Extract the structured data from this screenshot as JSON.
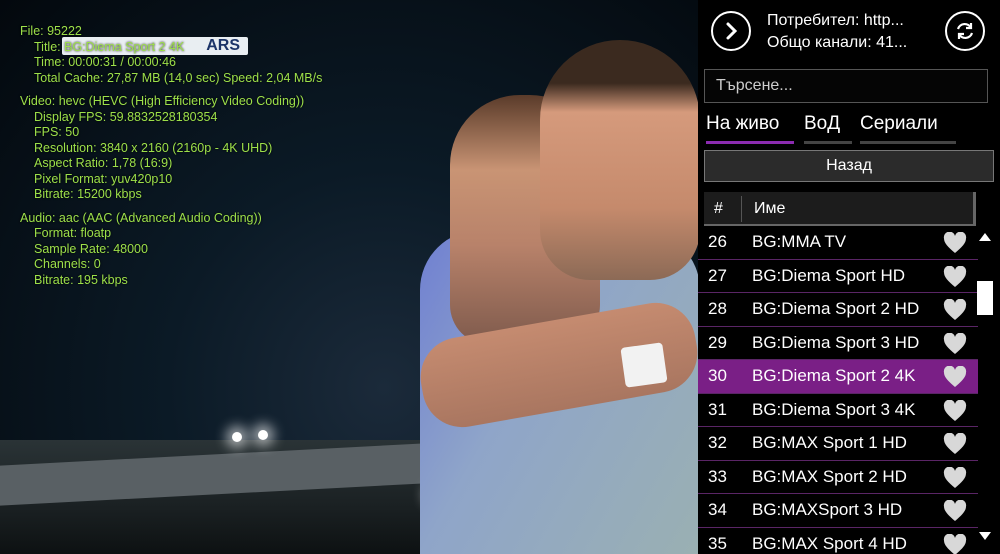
{
  "video": {
    "score_bug": "ARS",
    "info": {
      "file": "File: 95222",
      "title": "Title: BG:Diema Sport 2 4K",
      "time": "Time: 00:00:31 / 00:00:46",
      "cache": "Total Cache: 27,87 MB (14,0 sec) Speed: 2,04 MB/s",
      "video": "Video: hevc (HEVC (High Efficiency Video Coding))",
      "display_fps": "Display FPS: 59.8832528180354",
      "fps": "FPS: 50",
      "resolution": "Resolution: 3840 x 2160 (2160p - 4K UHD)",
      "aspect": "Aspect Ratio: 1,78 (16:9)",
      "pixel_format": "Pixel Format: yuv420p10",
      "video_bitrate": "Bitrate: 15200 kbps",
      "audio": "Audio: aac (AAC (Advanced Audio Coding))",
      "format": "Format: floatp",
      "sample_rate": "Sample Rate: 48000",
      "channels": "Channels: 0",
      "audio_bitrate": "Bitrate: 195 kbps"
    }
  },
  "panel": {
    "user_line": "Потребител: http...",
    "channels_line": "Общо канали: 41...",
    "search_placeholder": "Търсене...",
    "tabs": [
      {
        "label": "На живо",
        "active": true
      },
      {
        "label": "ВоД",
        "active": false
      },
      {
        "label": "Сериали",
        "active": false
      }
    ],
    "back_label": "Назад",
    "header": {
      "num": "#",
      "name": "Име"
    },
    "channels": [
      {
        "num": "26",
        "name": "BG:MMA TV"
      },
      {
        "num": "27",
        "name": "BG:Diema Sport HD"
      },
      {
        "num": "28",
        "name": "BG:Diema Sport 2 HD"
      },
      {
        "num": "29",
        "name": "BG:Diema Sport 3 HD"
      },
      {
        "num": "30",
        "name": "BG:Diema Sport 2 4K",
        "selected": true
      },
      {
        "num": "31",
        "name": "BG:Diema Sport 3 4K"
      },
      {
        "num": "32",
        "name": "BG:MAX Sport 1 HD"
      },
      {
        "num": "33",
        "name": "BG:MAX Sport 2 HD"
      },
      {
        "num": "34",
        "name": "BG:MAXSport 3 HD"
      },
      {
        "num": "35",
        "name": "BG:MAX Sport 4 HD"
      }
    ],
    "colors": {
      "accent": "#7a1f86",
      "info_text": "#9de04a",
      "heart": "#d8d8d8"
    }
  }
}
